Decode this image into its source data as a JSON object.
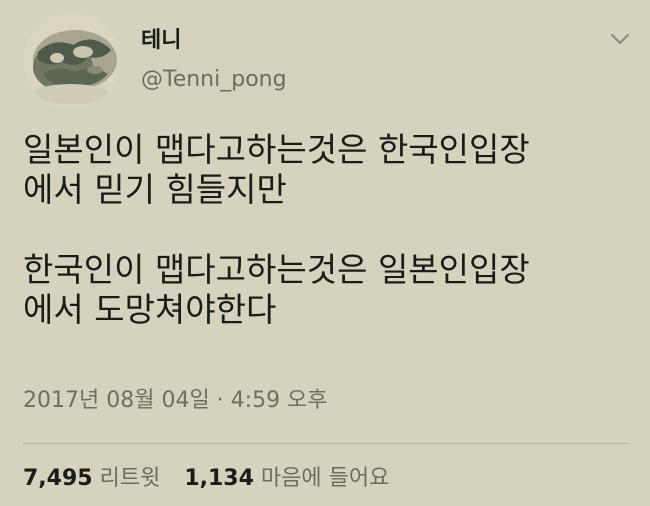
{
  "author": {
    "display_name": "테니",
    "handle": "@Tenni_pong",
    "avatar_icon": "profile-photo"
  },
  "menu_icon": "chevron-down-icon",
  "tweet": {
    "paragraph_1": "일본인이 맵다고하는것은 한국인입장\n에서 믿기 힘들지만",
    "paragraph_2": "한국인이 맵다고하는것은 일본인입장\n에서 도망쳐야한다"
  },
  "timestamp": "2017년 08월 04일 · 4:59 오후",
  "stats": {
    "retweets_count": "7,495",
    "retweets_label": "리트윗",
    "likes_count": "1,134",
    "likes_label": "마음에 들어요"
  },
  "colors": {
    "background": "#d5d3bd",
    "text": "#1b1b18",
    "secondary_text": "#6d6c62",
    "divider": "#b7b5a2"
  }
}
